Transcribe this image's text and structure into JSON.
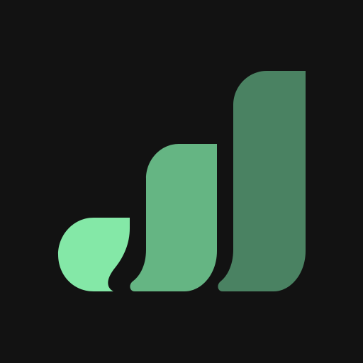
{
  "icon": {
    "name": "growth-bars-logo",
    "background_color": "#121212",
    "bar_colors": {
      "small": "#84E8A7",
      "medium": "#65B583",
      "large": "#4A8262"
    }
  }
}
